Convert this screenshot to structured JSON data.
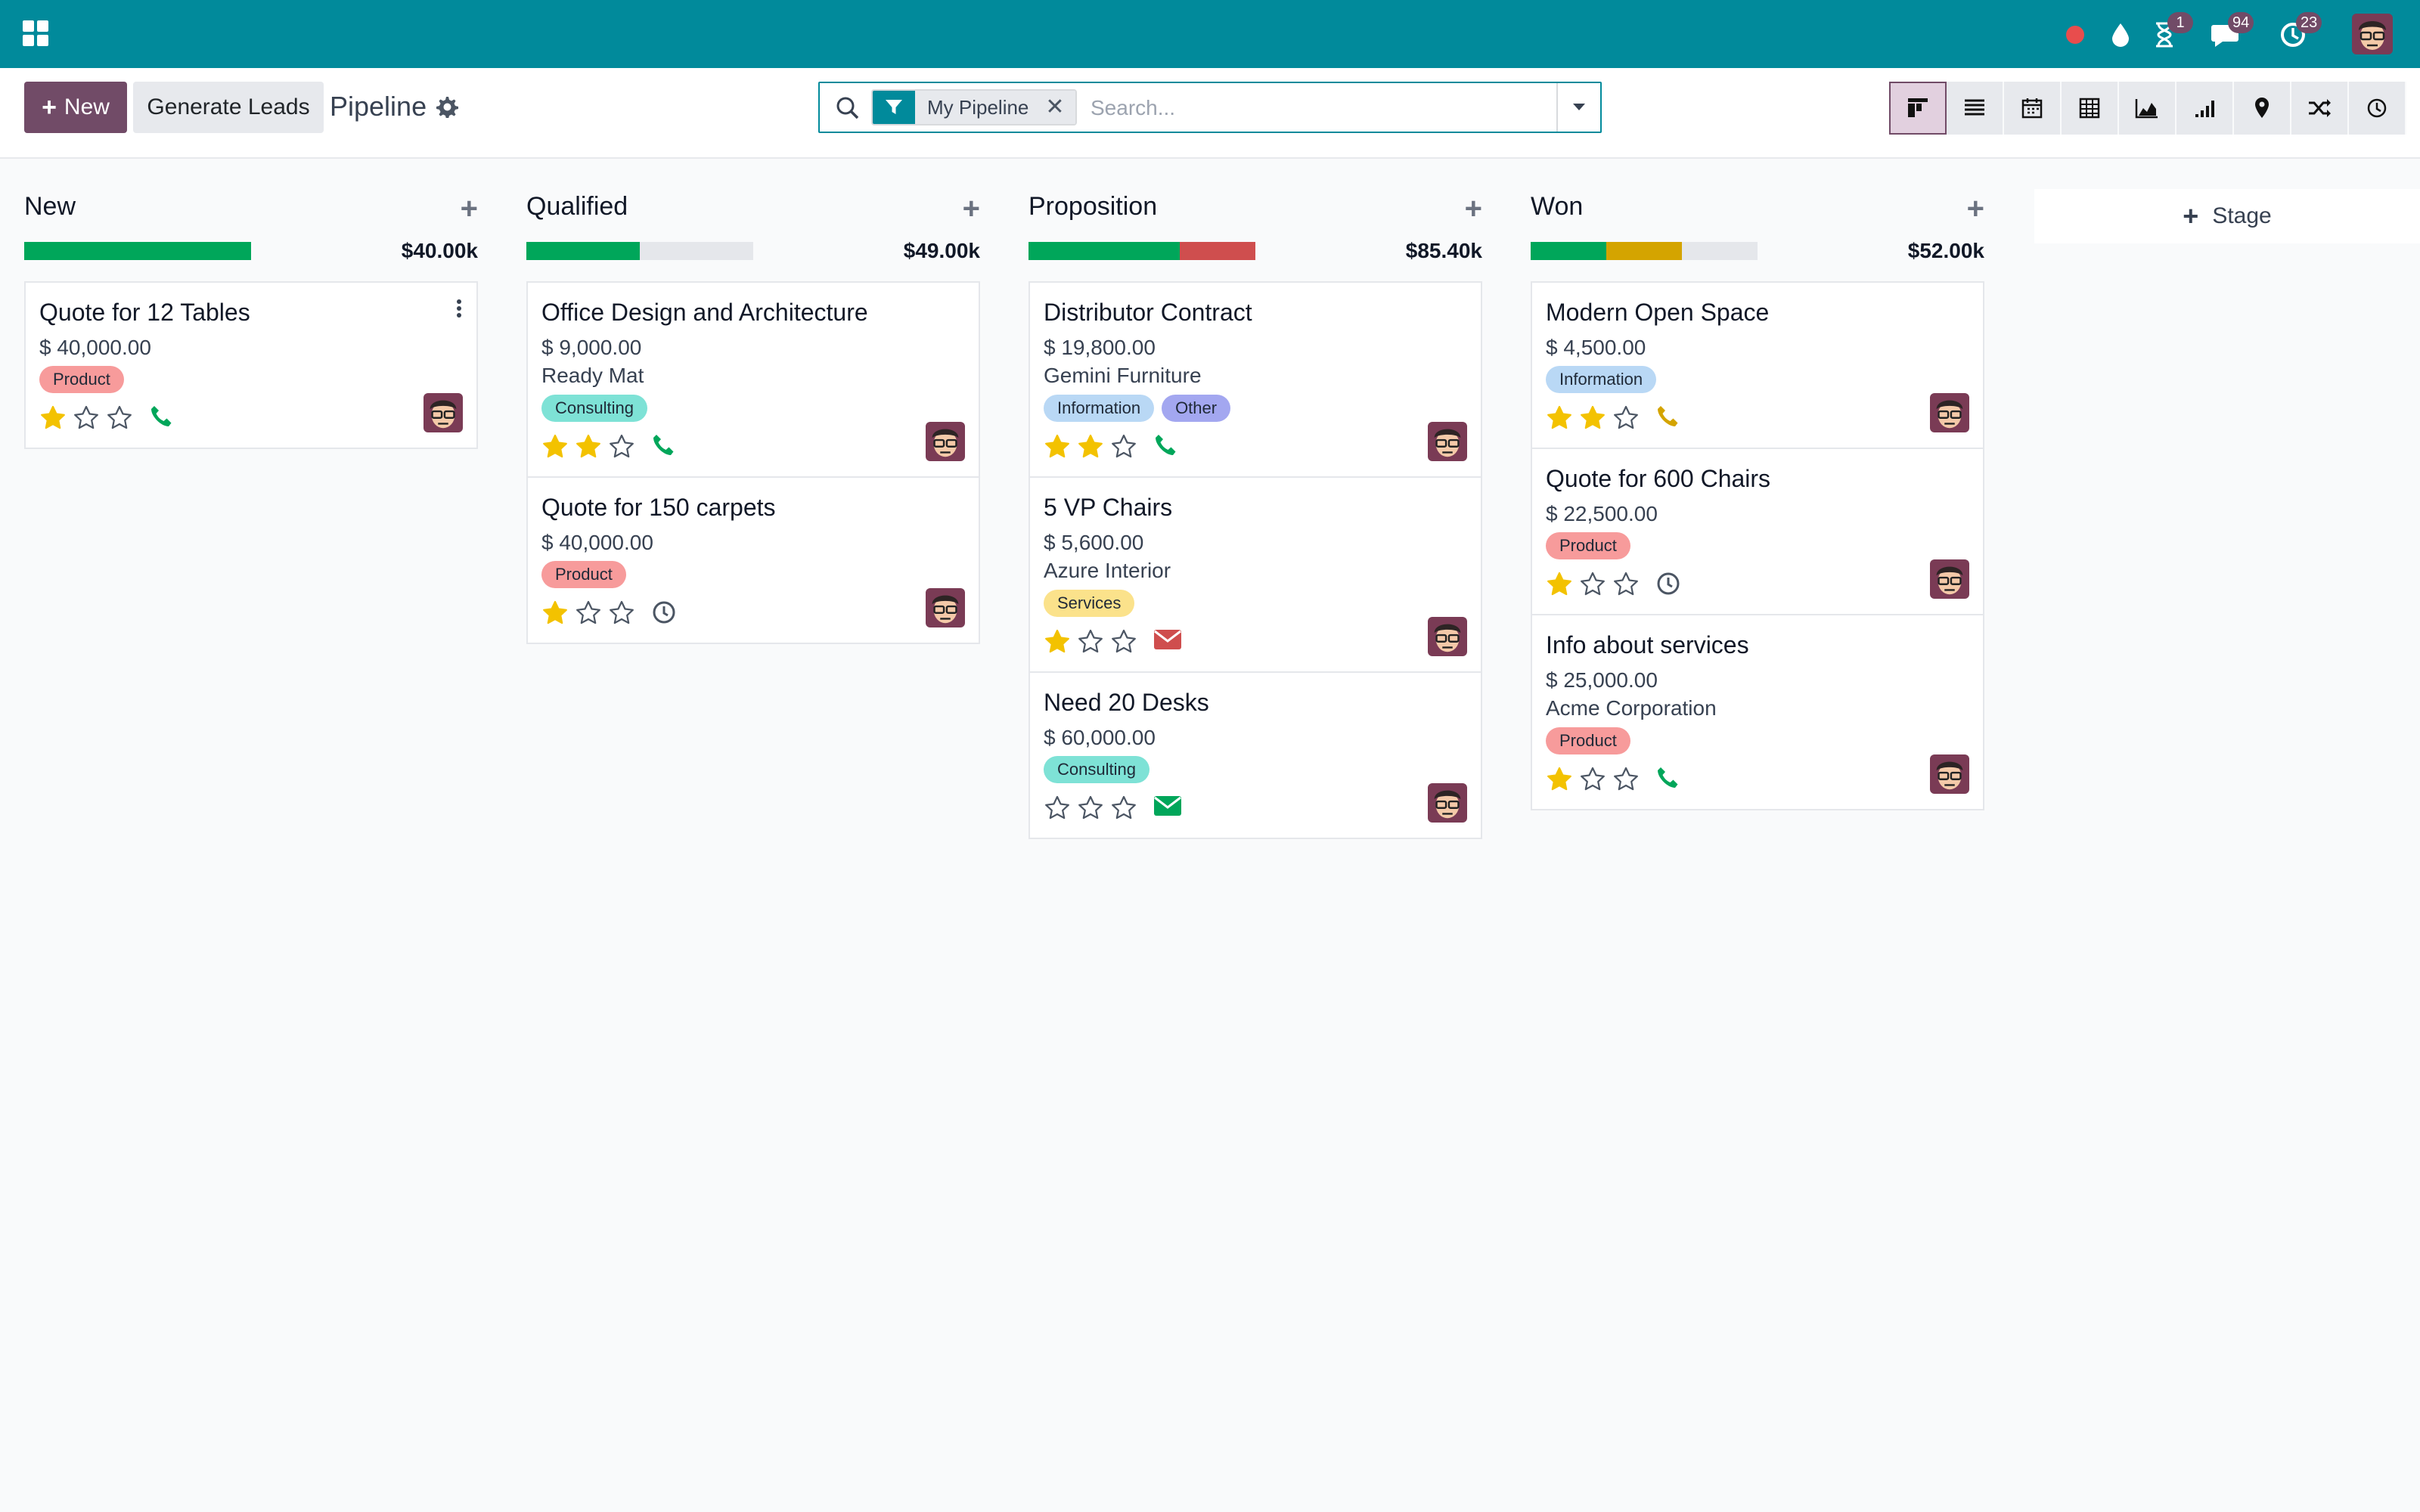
{
  "colors": {
    "navbar": "#018a9b",
    "primary": "#714b67",
    "progress_green": "#00a65a",
    "progress_red": "#cf4e4e",
    "progress_yellow": "#d4a400",
    "star_gold": "#f3c200"
  },
  "navbar": {
    "apps_icon": "apps-grid-icon",
    "record_icon": "record-dot-icon",
    "drop_icon": "drop-icon",
    "activity_badge": "1",
    "messages_badge": "94",
    "clock_badge": "23"
  },
  "control": {
    "new_label": "New",
    "generate_label": "Generate Leads",
    "title": "Pipeline",
    "facet_label": "My Pipeline",
    "search_placeholder": "Search..."
  },
  "views": [
    "kanban",
    "list",
    "calendar",
    "pivot",
    "graph",
    "cohort",
    "map",
    "random",
    "activity"
  ],
  "columns": [
    {
      "title": "New",
      "total": "$40.00k",
      "progress": [
        {
          "color": "#00a65a",
          "fraction": 1.0
        }
      ],
      "cards": [
        {
          "name": "Quote for 12 Tables",
          "amount": "$ 40,000.00",
          "partner": "",
          "tags": [
            {
              "label": "Product",
              "color": "#f79b9b"
            }
          ],
          "stars": 1,
          "activity": "phone",
          "menu": true
        }
      ]
    },
    {
      "title": "Qualified",
      "total": "$49.00k",
      "progress": [
        {
          "color": "#00a65a",
          "fraction": 0.5
        }
      ],
      "cards": [
        {
          "name": "Office Design and Architecture",
          "amount": "$ 9,000.00",
          "partner": "Ready Mat",
          "tags": [
            {
              "label": "Consulting",
              "color": "#7ee2d6"
            }
          ],
          "stars": 2,
          "activity": "phone"
        },
        {
          "name": "Quote for 150 carpets",
          "amount": "$ 40,000.00",
          "partner": "",
          "tags": [
            {
              "label": "Product",
              "color": "#f79b9b"
            }
          ],
          "stars": 1,
          "activity": "clock"
        }
      ]
    },
    {
      "title": "Proposition",
      "total": "$85.40k",
      "progress": [
        {
          "color": "#00a65a",
          "fraction": 0.667
        },
        {
          "color": "#cf4e4e",
          "fraction": 0.333
        }
      ],
      "cards": [
        {
          "name": "Distributor Contract",
          "amount": "$ 19,800.00",
          "partner": "Gemini Furniture",
          "tags": [
            {
              "label": "Information",
              "color": "#b9d8f5"
            },
            {
              "label": "Other",
              "color": "#a3a7f0"
            }
          ],
          "stars": 2,
          "activity": "phone"
        },
        {
          "name": "5 VP Chairs",
          "amount": "$ 5,600.00",
          "partner": "Azure Interior",
          "tags": [
            {
              "label": "Services",
              "color": "#fbe28b"
            }
          ],
          "stars": 1,
          "activity": "email-red"
        },
        {
          "name": "Need 20 Desks",
          "amount": "$ 60,000.00",
          "partner": "",
          "tags": [
            {
              "label": "Consulting",
              "color": "#7ee2d6"
            }
          ],
          "stars": 0,
          "activity": "email-green"
        }
      ]
    },
    {
      "title": "Won",
      "total": "$52.00k",
      "progress": [
        {
          "color": "#00a65a",
          "fraction": 0.333
        },
        {
          "color": "#d4a400",
          "fraction": 0.333
        }
      ],
      "cards": [
        {
          "name": "Modern Open Space",
          "amount": "$ 4,500.00",
          "partner": "",
          "tags": [
            {
              "label": "Information",
              "color": "#b9d8f5"
            }
          ],
          "stars": 2,
          "activity": "phone-yellow"
        },
        {
          "name": "Quote for 600 Chairs",
          "amount": "$ 22,500.00",
          "partner": "",
          "tags": [
            {
              "label": "Product",
              "color": "#f79b9b"
            }
          ],
          "stars": 1,
          "activity": "clock"
        },
        {
          "name": "Info about services",
          "amount": "$ 25,000.00",
          "partner": "Acme Corporation",
          "tags": [
            {
              "label": "Product",
              "color": "#f79b9b"
            }
          ],
          "stars": 1,
          "activity": "phone"
        }
      ]
    }
  ],
  "stage_add_label": "Stage"
}
